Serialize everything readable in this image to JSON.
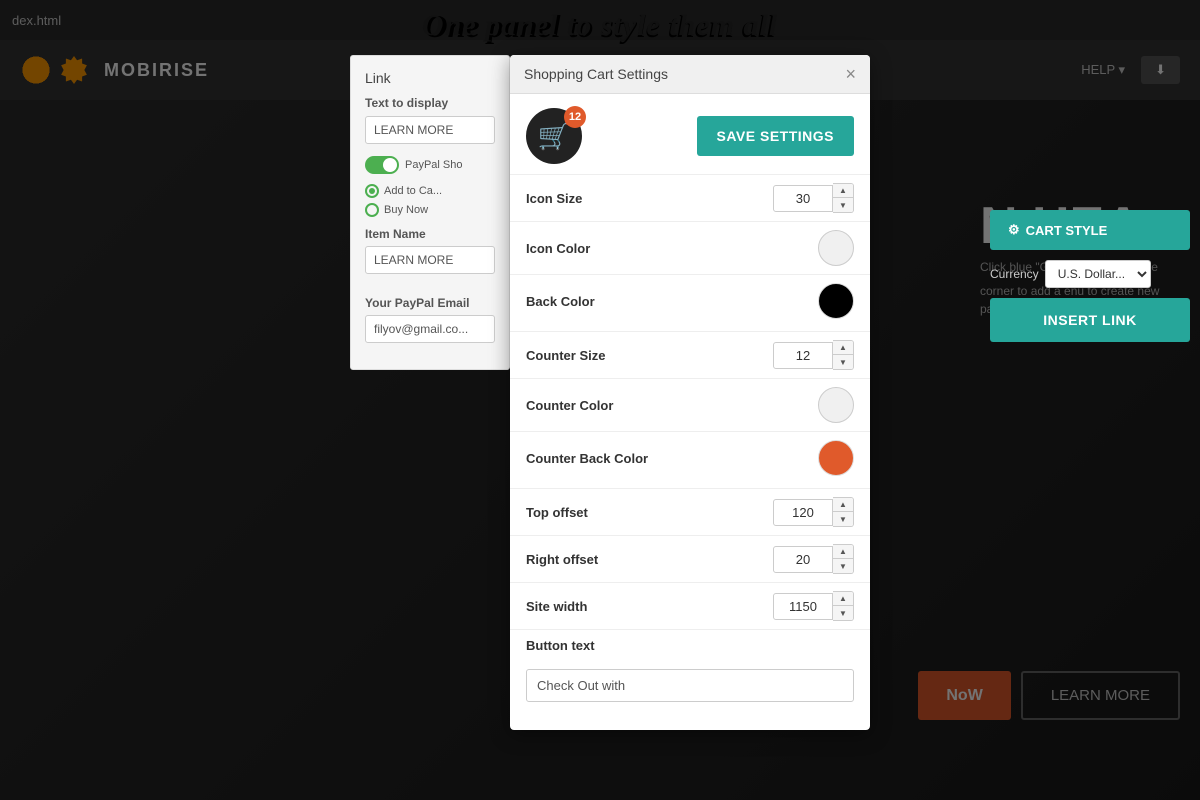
{
  "topbar": {
    "filename": "dex.html"
  },
  "header": {
    "brand": "MOBIRISE",
    "help_label": "HELP ▾",
    "download_label": "⬇"
  },
  "page_title": {
    "text": "One panel to style them all"
  },
  "background": {
    "headline": "N HEA",
    "desc": "Click blue \"Gear\" uttons, text, title",
    "desc2": "corner to add a enu to create new pages, sites",
    "btn_now": "NoW",
    "btn_learn": "LEARN MORE"
  },
  "link_panel": {
    "title": "Link",
    "text_to_display_label": "Text to display",
    "text_to_display_value": "LEARN MORE",
    "paypal_label": "PayPal Sho",
    "add_to_cart_label": "Add to Ca...",
    "buy_now_label": "Buy Now",
    "item_name_label": "Item Name",
    "item_name_value": "LEARN MORE",
    "your_paypal_email_label": "Your PayPal Email",
    "your_paypal_email_value": "filyov@gmail.co..."
  },
  "shopping_cart": {
    "title": "Shopping Cart Settings",
    "close_label": "×",
    "cart_badge_count": "12",
    "save_settings_label": "SAVE SETTINGS",
    "icon_size_label": "Icon Size",
    "icon_size_value": "30",
    "icon_color_label": "Icon Color",
    "icon_color_value": "#ffffff",
    "back_color_label": "Back Color",
    "back_color_value": "#000000",
    "counter_size_label": "Counter Size",
    "counter_size_value": "12",
    "counter_color_label": "Counter Color",
    "counter_color_value": "#ffffff",
    "counter_back_color_label": "Counter Back Color",
    "counter_back_color_value": "#e05a2b",
    "top_offset_label": "Top offset",
    "top_offset_value": "120",
    "right_offset_label": "Right offset",
    "right_offset_value": "20",
    "site_width_label": "Site width",
    "site_width_value": "1150",
    "button_text_label": "Button text",
    "button_text_value": "Check Out with"
  },
  "right_panel": {
    "cart_style_label": "CART STYLE",
    "currency_label": "Currency",
    "currency_value": "U.S. Dollar...",
    "insert_link_label": "INSERT LINK"
  }
}
